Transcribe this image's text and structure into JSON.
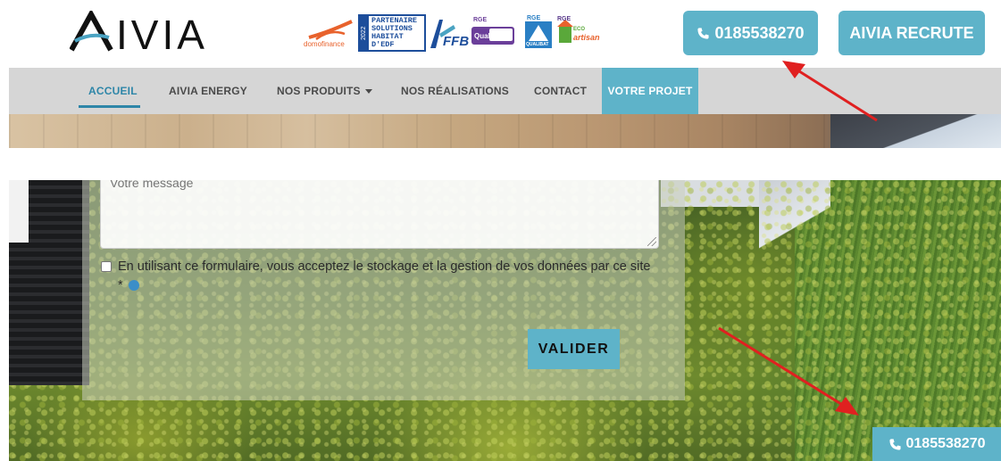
{
  "header": {
    "logo_text": "AIVIA",
    "partners": {
      "domofinance": "domofinance",
      "edf_year": "2022",
      "edf_lines": [
        "PARTENAIRE",
        "SOLUTIONS",
        "HABITAT",
        "D'EDF"
      ],
      "ffb": "FFB",
      "qualipac_top": "RGE",
      "qualipac": "QualiPac",
      "qualibat_top": "RGE",
      "qualibat": "QUALIBAT",
      "eco_top": "RGE",
      "eco": "ECO",
      "eco_bottom": "artisan"
    },
    "phone_button": "0185538270",
    "recruit_button": "AIVIA RECRUTE"
  },
  "nav": {
    "items": [
      {
        "label": "ACCUEIL",
        "active": true
      },
      {
        "label": "AIVIA ENERGY"
      },
      {
        "label": "NOS PRODUITS"
      },
      {
        "label": "NOS RÉALISATIONS"
      },
      {
        "label": "CONTACT"
      },
      {
        "label": "VOTRE PROJET"
      }
    ]
  },
  "form": {
    "message_placeholder": "Votre message",
    "consent_text": "En utilisant ce formulaire, vous acceptez le stockage et la gestion de vos données par ce site *",
    "submit_button": "VALIDER"
  },
  "floating_phone": "0185538270",
  "colors": {
    "accent": "#5eb3c9",
    "nav_bg": "#d6d6d6",
    "nav_active": "#2e86a8",
    "annotation_arrow": "#e02020"
  },
  "icons": {
    "phone": "phone-icon",
    "caret": "caret-down-icon",
    "info": "info-icon"
  }
}
